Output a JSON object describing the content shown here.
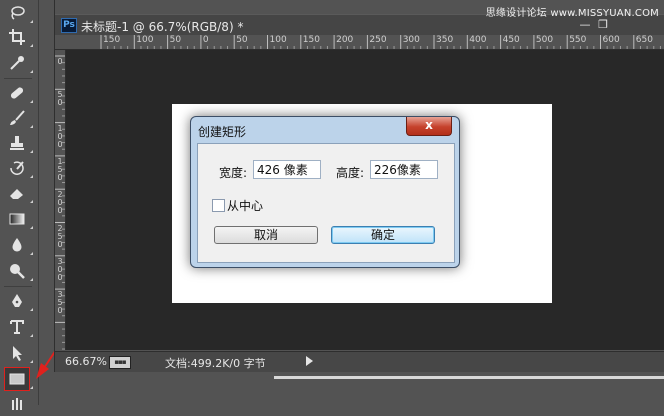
{
  "document": {
    "title": "未标题-1 @ 66.7%(RGB/8) *",
    "app_icon_text": "Ps",
    "watermark": "思缘设计论坛 www.MISSYUAN.COM",
    "minimize": "—",
    "restore": "❐",
    "ruler_top_labels": [
      "150",
      "100",
      "50",
      "0",
      "50",
      "100",
      "150",
      "200",
      "250",
      "300",
      "350",
      "400",
      "450",
      "500",
      "550",
      "600",
      "650",
      "7"
    ],
    "ruler_left_labels": [
      "0",
      "50",
      "100",
      "150",
      "200",
      "250",
      "300",
      "350"
    ],
    "status": {
      "zoom": "66.67%",
      "info": "文档:499.2K/0 字节"
    }
  },
  "dialog": {
    "title": "创建矩形",
    "close_label": "x",
    "width_label": "宽度:",
    "width_value": "426 像素",
    "height_label": "高度:",
    "height_value": "226像素",
    "from_center_label": "从中心",
    "from_center_checked": false,
    "cancel_label": "取消",
    "ok_label": "确定"
  },
  "toolbar": {
    "active_tool": "rectangle-tool",
    "highlight_color": "#e0211d"
  }
}
